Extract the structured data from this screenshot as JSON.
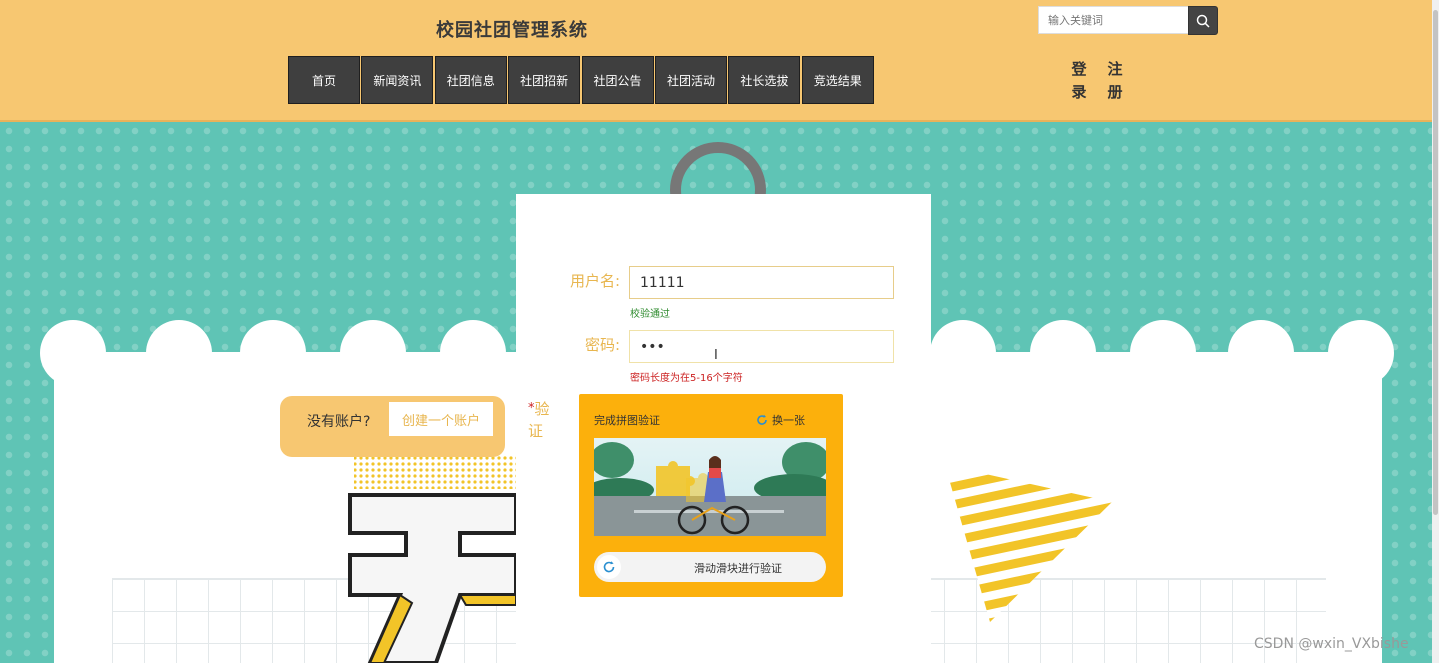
{
  "header": {
    "site_title": "校园社团管理系统",
    "search_placeholder": "输入关键词",
    "nav": [
      "首页",
      "新闻资讯",
      "社团信息",
      "社团招新",
      "社团公告",
      "社团活动",
      "社长选拔",
      "竞选结果"
    ],
    "login": "登录",
    "register": "注册"
  },
  "login_form": {
    "username_label": "用户名:",
    "username_value": "11111",
    "username_hint": "校验通过",
    "password_label": "密码:",
    "password_value": "•••",
    "password_hint": "密码长度为在5-16个字符",
    "no_account_text": "没有账户?",
    "create_account": "创建一个账户",
    "verify_star": "*",
    "verify_label": "验证"
  },
  "captcha": {
    "title": "完成拼图验证",
    "refresh": "换一张",
    "slider_text": "滑动滑块进行验证"
  },
  "colors": {
    "header_bg": "#f7c771",
    "accent": "#e8b64f",
    "captcha_bg": "#fcb00c",
    "nav_bg": "#3f3f3f"
  },
  "watermark": "CSDN @wxin_VXbishe"
}
